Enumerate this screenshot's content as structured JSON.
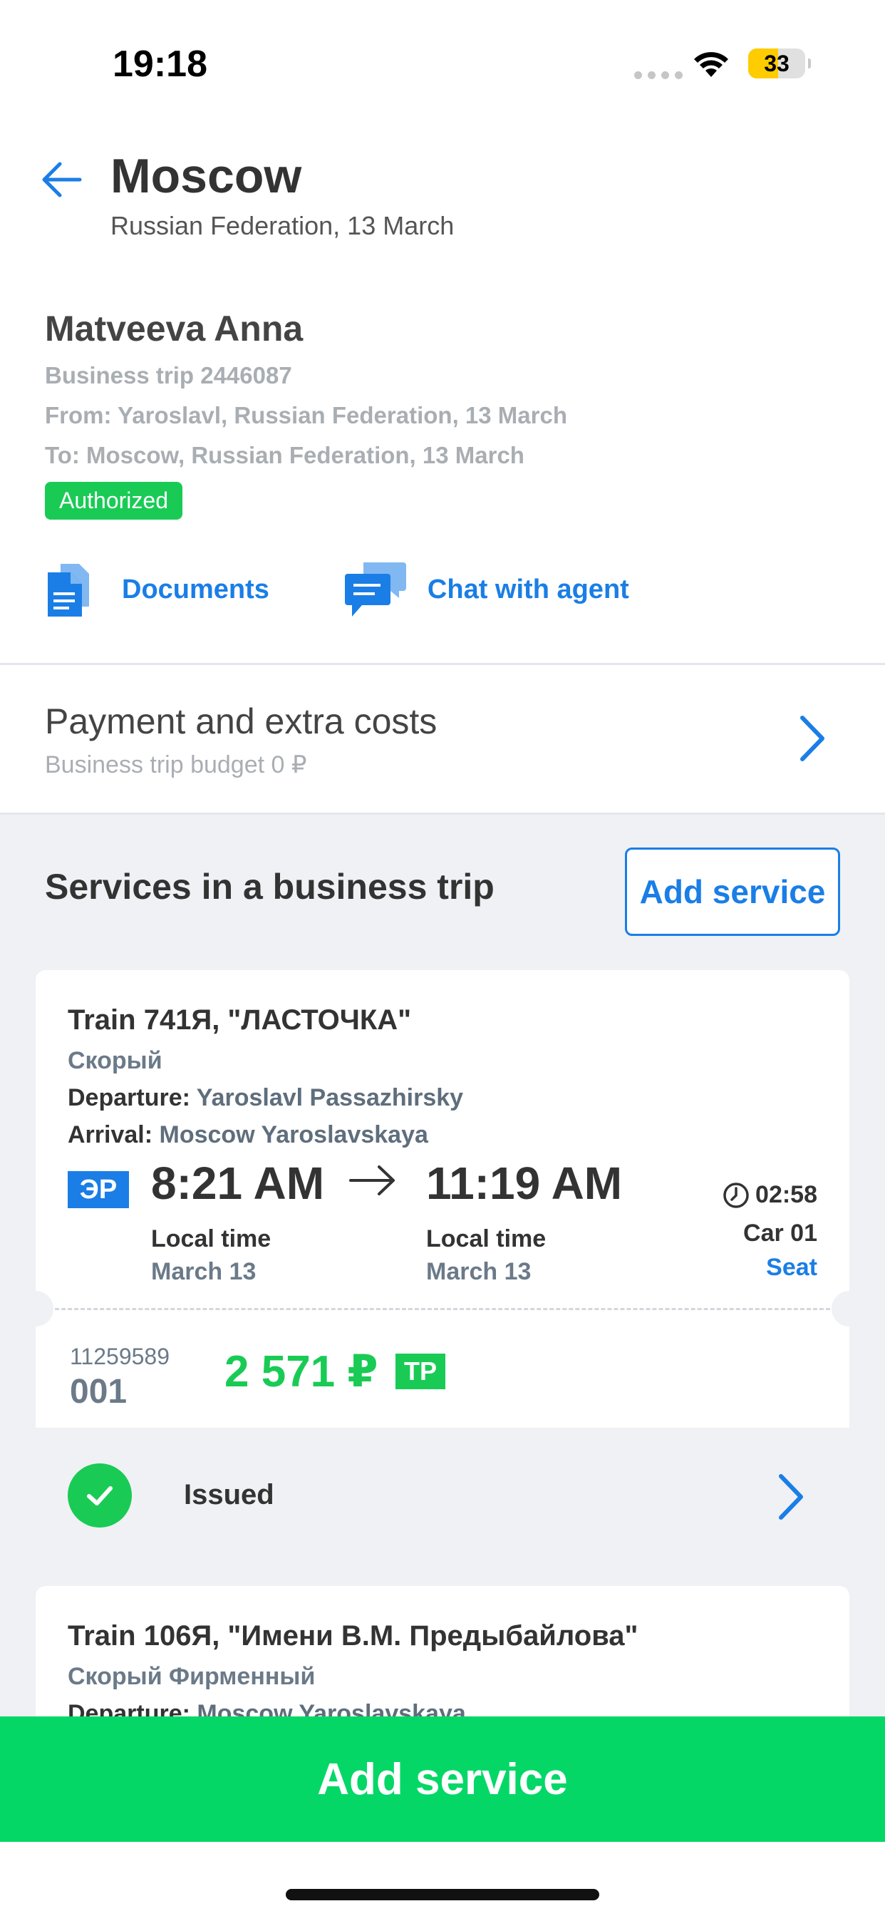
{
  "status_bar": {
    "time": "19:18",
    "battery": "33"
  },
  "header": {
    "title": "Moscow",
    "subtitle": "Russian Federation, 13 March"
  },
  "traveler": {
    "name": "Matveeva Anna",
    "trip": "Business trip 2446087",
    "from": "From: Yaroslavl, Russian Federation, 13 March",
    "to": "To: Moscow, Russian Federation, 13 March",
    "status": "Authorized"
  },
  "actions": {
    "documents": "Documents",
    "chat": "Chat with agent"
  },
  "payment": {
    "title": "Payment and extra costs",
    "budget": "Business trip budget 0 ₽"
  },
  "services": {
    "heading": "Services in a business trip",
    "add_label": "Add service",
    "cards": [
      {
        "train": "Train 741Я, \"ЛАСТОЧКА\"",
        "class": "Скорый",
        "departure_label": "Departure:",
        "departure": "Yaroslavl Passazhirsky",
        "arrival_label": "Arrival:",
        "arrival": "Moscow Yaroslavskaya",
        "badge": "ЭР",
        "dep_time": "8:21 AM",
        "arr_time": "11:19 AM",
        "dep_local": "Local time",
        "dep_date": "March 13",
        "arr_local": "Local time",
        "arr_date": "March 13",
        "duration": "02:58",
        "car": "Car 01",
        "seat": "Seat",
        "ticket_number": "11259589",
        "ticket_seq": "001",
        "price": "2 571 ₽",
        "tariff": "ТР",
        "status": "Issued"
      },
      {
        "train": "Train 106Я, \"Имени В.М. Предыбайлова\"",
        "class": "Скорый Фирменный",
        "departure_label": "Departure:",
        "departure": "Moscow Yaroslavskaya"
      }
    ]
  },
  "bottom_button": {
    "label": "Add service"
  },
  "colors": {
    "accent": "#1a7ee6",
    "success": "#19cb55",
    "cta": "#05d767"
  }
}
